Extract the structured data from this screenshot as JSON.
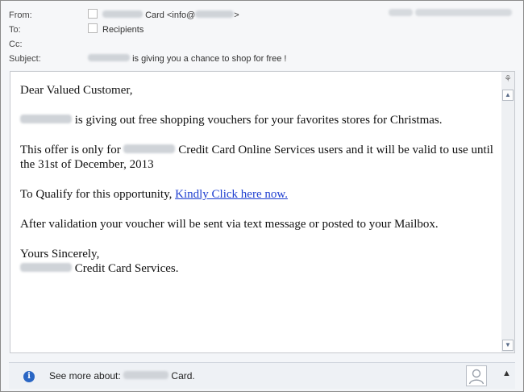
{
  "header": {
    "from_label": "From:",
    "to_label": "To:",
    "cc_label": "Cc:",
    "subject_label": "Subject:",
    "from_value": "Card <info@",
    "from_suffix": ">",
    "to_value": "Recipients",
    "subject_value": "is giving you a chance to shop for free !",
    "sent_label": "Sent:"
  },
  "email": {
    "greeting": "Dear Valued Customer,",
    "p1": "is giving out free shopping vouchers for your favorites stores for Christmas.",
    "p2a": "This offer is only for",
    "p2b": "Credit Card Online Services users and it will be valid to use until the 31st of December, 2013",
    "p3": "To Qualify for this opportunity,",
    "link_text": "Kindly Click here now.",
    "p4": "After validation your voucher will be sent via text message or posted to your Mailbox.",
    "closing": "Yours Sincerely,",
    "signature": "Credit Card Services."
  },
  "footer": {
    "see_more": "See more about:",
    "see_more_suffix": "Card."
  },
  "icons": {
    "info": "info-icon",
    "contact": "contact-photo-icon",
    "expand": "chevron-up-icon",
    "feed": "rss-feed-icon"
  },
  "colors": {
    "link": "#1f3fd0",
    "info_badge": "#2a66c4"
  }
}
